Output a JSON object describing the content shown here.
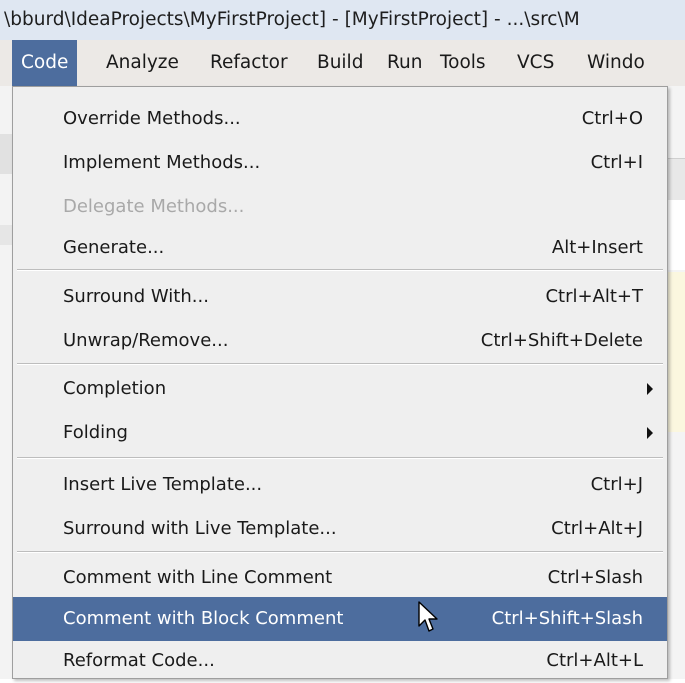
{
  "window": {
    "title": "\\bburd\\IdeaProjects\\MyFirstProject] - [MyFirstProject] - ...\\src\\M"
  },
  "menubar": {
    "items": [
      "Code",
      "Analyze",
      "Refactor",
      "Build",
      "Run",
      "Tools",
      "VCS",
      "Windo"
    ],
    "active": "Code"
  },
  "code_menu": {
    "items": [
      {
        "label": "Override Methods...",
        "shortcut": "Ctrl+O"
      },
      {
        "label": "Implement Methods...",
        "shortcut": "Ctrl+I"
      },
      {
        "label": "Delegate Methods...",
        "shortcut": "",
        "disabled": true
      },
      {
        "label": "Generate...",
        "shortcut": "Alt+Insert"
      },
      {
        "label": "Surround With...",
        "shortcut": "Ctrl+Alt+T"
      },
      {
        "label": "Unwrap/Remove...",
        "shortcut": "Ctrl+Shift+Delete"
      },
      {
        "label": "Completion",
        "shortcut": "",
        "submenu": true
      },
      {
        "label": "Folding",
        "shortcut": "",
        "submenu": true
      },
      {
        "label": "Insert Live Template...",
        "shortcut": "Ctrl+J"
      },
      {
        "label": "Surround with Live Template...",
        "shortcut": "Ctrl+Alt+J"
      },
      {
        "label": "Comment with Line Comment",
        "shortcut": "Ctrl+Slash"
      },
      {
        "label": "Comment with Block Comment",
        "shortcut": "Ctrl+Shift+Slash",
        "selected": true
      },
      {
        "label": "Reformat Code...",
        "shortcut": "Ctrl+Alt+L"
      }
    ]
  },
  "colors": {
    "selection": "#4d6d9e",
    "menu_bg": "#efefef",
    "disabled_text": "#a9a9a9"
  },
  "icons": [
    "submenu-arrow-icon",
    "mouse-pointer-icon"
  ]
}
